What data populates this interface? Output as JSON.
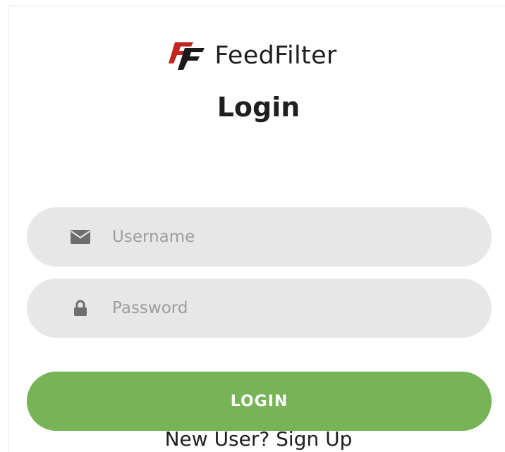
{
  "brand": {
    "name": "FeedFilter",
    "logo_icon": "feedfilter-logo",
    "colors": {
      "logo_red": "#c0251f",
      "logo_black": "#1a1a1a"
    }
  },
  "form": {
    "title": "Login",
    "username": {
      "placeholder": "Username",
      "value": "",
      "icon": "envelope-icon"
    },
    "password": {
      "placeholder": "Password",
      "value": "",
      "icon": "lock-icon"
    },
    "login_label": "LOGIN",
    "signup_text": "New User? Sign Up"
  },
  "colors": {
    "accent": "#76b457",
    "field_bg": "#e7e7e7",
    "placeholder": "#9d9d9d",
    "text": "#1f1f1f"
  }
}
